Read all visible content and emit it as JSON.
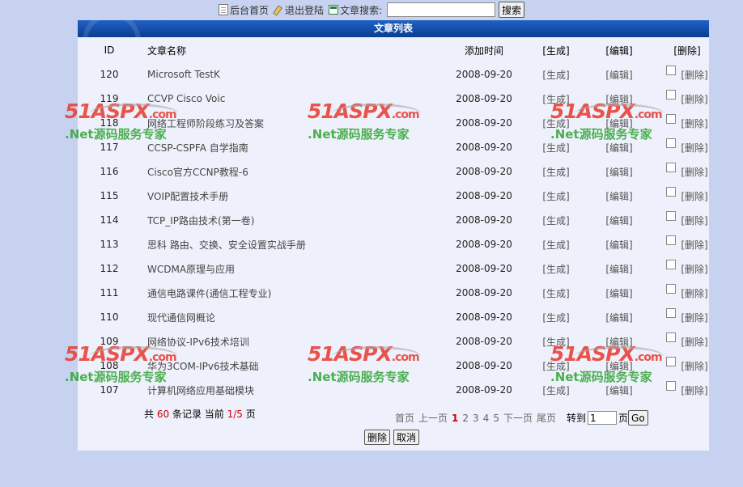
{
  "topnav": {
    "home_label": "后台首页",
    "logout_label": "退出登陆",
    "search_label": "文章搜索:",
    "search_value": "",
    "search_button": "搜索",
    "icons": [
      "document-icon",
      "key-icon",
      "search-list-icon"
    ]
  },
  "panel": {
    "title": "文章列表"
  },
  "table": {
    "headers": {
      "id": "ID",
      "name": "文章名称",
      "time": "添加时间",
      "gen": "[生成]",
      "edit": "[编辑]",
      "del": "[删除]"
    },
    "gen_label": "[生成]",
    "edit_label": "[编辑]",
    "del_label": "[删除]",
    "rows": [
      {
        "id": "120",
        "name": "Microsoft TestK",
        "time": "2008-09-20"
      },
      {
        "id": "119",
        "name": "CCVP Cisco Voic",
        "time": "2008-09-20"
      },
      {
        "id": "118",
        "name": "网络工程师阶段练习及答案",
        "time": "2008-09-20"
      },
      {
        "id": "117",
        "name": "CCSP-CSPFA 自学指南",
        "time": "2008-09-20"
      },
      {
        "id": "116",
        "name": "Cisco官方CCNP教程-6",
        "time": "2008-09-20"
      },
      {
        "id": "115",
        "name": "VOIP配置技术手册",
        "time": "2008-09-20"
      },
      {
        "id": "114",
        "name": "TCP_IP路由技术(第一卷)",
        "time": "2008-09-20"
      },
      {
        "id": "113",
        "name": "思科 路由、交换、安全设置实战手册",
        "time": "2008-09-20"
      },
      {
        "id": "112",
        "name": "WCDMA原理与应用",
        "time": "2008-09-20"
      },
      {
        "id": "111",
        "name": "通信电路课件(通信工程专业)",
        "time": "2008-09-20"
      },
      {
        "id": "110",
        "name": "现代通信网概论",
        "time": "2008-09-20"
      },
      {
        "id": "109",
        "name": "网络协议-IPv6技术培训",
        "time": "2008-09-20"
      },
      {
        "id": "108",
        "name": "华为3COM-IPv6技术基础",
        "time": "2008-09-20"
      },
      {
        "id": "107",
        "name": "计算机网络应用基础模块",
        "time": "2008-09-20"
      }
    ]
  },
  "summary": {
    "prefix": "共",
    "total": "60",
    "mid": "条记录  当前",
    "page": "1/5",
    "suffix": "页"
  },
  "pager": {
    "first": "首页",
    "prev": "上一页",
    "pages": [
      "1",
      "2",
      "3",
      "4",
      "5"
    ],
    "current": "1",
    "next": "下一页",
    "last": "尾页",
    "goto_label": "转到",
    "goto_value": "1",
    "page_unit": "页",
    "go_button": "Go"
  },
  "actions": {
    "delete": "删除",
    "cancel": "取消"
  },
  "watermark": {
    "brand_num": "51",
    "brand_text": "ASPX",
    "domain": ".com",
    "tagline": ".Net源码服务专家"
  },
  "colors": {
    "header_blue": "#0b3d91",
    "panel_bg": "#eef1fb",
    "page_bg": "#c7d2f0",
    "accent_red": "#cc0000",
    "watermark_red": "#e8433a",
    "watermark_green": "#3aa83f"
  }
}
